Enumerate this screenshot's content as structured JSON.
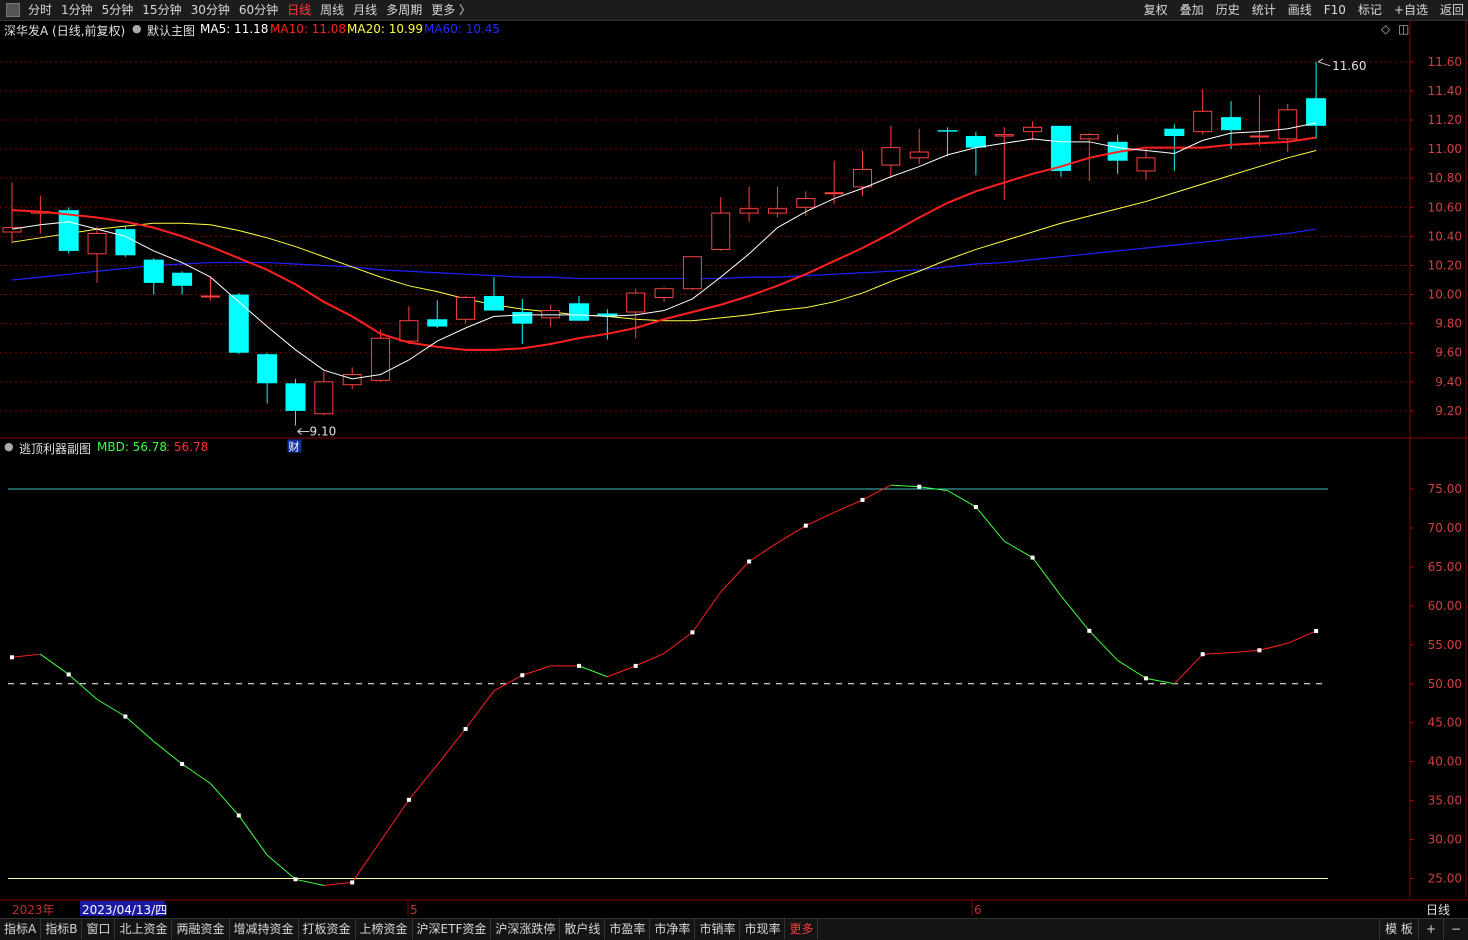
{
  "toolbar": {
    "periods": [
      {
        "label": "分时",
        "active": false
      },
      {
        "label": "1分钟",
        "active": false
      },
      {
        "label": "5分钟",
        "active": false
      },
      {
        "label": "15分钟",
        "active": false
      },
      {
        "label": "30分钟",
        "active": false
      },
      {
        "label": "60分钟",
        "active": false
      },
      {
        "label": "日线",
        "active": true
      },
      {
        "label": "周线",
        "active": false
      },
      {
        "label": "月线",
        "active": false
      },
      {
        "label": "多周期",
        "active": false
      },
      {
        "label": "更多 〉",
        "active": false
      }
    ],
    "right_items": [
      "复权",
      "叠加",
      "历史",
      "统计",
      "画线",
      "F10",
      "标记",
      "+自选",
      "返回"
    ]
  },
  "main_chart": {
    "title": "深华发A (日线,前复权)",
    "template": "默认主图",
    "ma5": {
      "label": "MA5: 11.18",
      "color": "#ffffff"
    },
    "ma10": {
      "label": "MA10: 11.08",
      "color": "#ff2020"
    },
    "ma20": {
      "label": "MA20: 10.99",
      "color": "#ffff40"
    },
    "ma60": {
      "label": "MA60: 10.45",
      "color": "#2020ff"
    },
    "high_label": "11.60",
    "low_label": "9.10",
    "finance_marker": "财",
    "price_ticks": [
      "11.60",
      "11.40",
      "11.20",
      "11.00",
      "10.80",
      "10.60",
      "10.40",
      "10.20",
      "10.00",
      "9.80",
      "9.60",
      "9.40",
      "9.20"
    ]
  },
  "sub_chart": {
    "title": "逃顶利器副图",
    "mbd_label": "MBD: 56.78",
    "mbd_value": ": 56.78",
    "ticks": [
      "75.00",
      "70.00",
      "65.00",
      "60.00",
      "55.00",
      "50.00",
      "45.00",
      "40.00",
      "35.00",
      "30.00",
      "25.00"
    ]
  },
  "time_axis": {
    "year_label": "2023年",
    "cursor_date": "2023/04/13/四",
    "month_5": "5",
    "month_6": "6",
    "period_label": "日线"
  },
  "bottom_tabs": [
    {
      "label": "指标A",
      "active": false
    },
    {
      "label": "指标B",
      "active": false
    },
    {
      "label": "窗口",
      "active": false
    },
    {
      "label": "北上资金",
      "active": false
    },
    {
      "label": "两融资金",
      "active": false
    },
    {
      "label": "增减持资金",
      "active": false
    },
    {
      "label": "打板资金",
      "active": false
    },
    {
      "label": "上榜资金",
      "active": false
    },
    {
      "label": "沪深ETF资金",
      "active": false
    },
    {
      "label": "沪深涨跌停",
      "active": false
    },
    {
      "label": "散户线",
      "active": false
    },
    {
      "label": "市盈率",
      "active": false
    },
    {
      "label": "市净率",
      "active": false
    },
    {
      "label": "市销率",
      "active": false
    },
    {
      "label": "市现率",
      "active": false
    },
    {
      "label": "更多",
      "active": true
    }
  ],
  "bottom_right": {
    "template_label": "模 板",
    "plus": "+",
    "minus": "−"
  },
  "colors": {
    "up": "#ff4040",
    "down": "#00ffff",
    "ma5": "#ffffff",
    "ma10": "#ff2020",
    "ma20": "#ffff40",
    "ma60": "#2020ff",
    "mbd_up": "#ff2020",
    "mbd_down": "#40ff40",
    "grid": "#7a0000"
  },
  "chart_data": [
    {
      "type": "candlestick",
      "title": "深华发A (日线,前复权)",
      "candles": [
        {
          "o": 10.43,
          "h": 10.77,
          "l": 10.35,
          "c": 10.46
        },
        {
          "o": 10.56,
          "h": 10.68,
          "l": 10.42,
          "c": 10.57
        },
        {
          "o": 10.58,
          "h": 10.6,
          "l": 10.28,
          "c": 10.3
        },
        {
          "o": 10.28,
          "h": 10.47,
          "l": 10.08,
          "c": 10.42
        },
        {
          "o": 10.45,
          "h": 10.47,
          "l": 10.26,
          "c": 10.27
        },
        {
          "o": 10.24,
          "h": 10.25,
          "l": 10.0,
          "c": 10.08
        },
        {
          "o": 10.15,
          "h": 10.16,
          "l": 10.0,
          "c": 10.06
        },
        {
          "o": 9.99,
          "h": 10.12,
          "l": 9.96,
          "c": 9.99
        },
        {
          "o": 10.0,
          "h": 10.01,
          "l": 9.59,
          "c": 9.6
        },
        {
          "o": 9.59,
          "h": 9.6,
          "l": 9.25,
          "c": 9.39
        },
        {
          "o": 9.39,
          "h": 9.42,
          "l": 9.1,
          "c": 9.2
        },
        {
          "o": 9.18,
          "h": 9.47,
          "l": 9.17,
          "c": 9.4
        },
        {
          "o": 9.38,
          "h": 9.5,
          "l": 9.35,
          "c": 9.45
        },
        {
          "o": 9.41,
          "h": 9.76,
          "l": 9.4,
          "c": 9.7
        },
        {
          "o": 9.68,
          "h": 9.92,
          "l": 9.66,
          "c": 9.82
        },
        {
          "o": 9.83,
          "h": 9.96,
          "l": 9.77,
          "c": 9.78
        },
        {
          "o": 9.83,
          "h": 9.99,
          "l": 9.8,
          "c": 9.98
        },
        {
          "o": 9.99,
          "h": 10.12,
          "l": 9.89,
          "c": 9.89
        },
        {
          "o": 9.88,
          "h": 9.97,
          "l": 9.66,
          "c": 9.8
        },
        {
          "o": 9.84,
          "h": 9.93,
          "l": 9.78,
          "c": 9.89
        },
        {
          "o": 9.94,
          "h": 9.99,
          "l": 9.83,
          "c": 9.82
        },
        {
          "o": 9.87,
          "h": 9.9,
          "l": 9.69,
          "c": 9.85
        },
        {
          "o": 9.88,
          "h": 10.04,
          "l": 9.7,
          "c": 10.01
        },
        {
          "o": 9.98,
          "h": 10.05,
          "l": 9.95,
          "c": 10.04
        },
        {
          "o": 10.04,
          "h": 10.26,
          "l": 10.03,
          "c": 10.26
        },
        {
          "o": 10.31,
          "h": 10.67,
          "l": 10.3,
          "c": 10.56
        },
        {
          "o": 10.56,
          "h": 10.74,
          "l": 10.5,
          "c": 10.59
        },
        {
          "o": 10.56,
          "h": 10.74,
          "l": 10.53,
          "c": 10.59
        },
        {
          "o": 10.6,
          "h": 10.71,
          "l": 10.54,
          "c": 10.66
        },
        {
          "o": 10.7,
          "h": 10.92,
          "l": 10.62,
          "c": 10.7
        },
        {
          "o": 10.74,
          "h": 10.99,
          "l": 10.68,
          "c": 10.86
        },
        {
          "o": 10.89,
          "h": 11.16,
          "l": 10.8,
          "c": 11.01
        },
        {
          "o": 10.94,
          "h": 11.14,
          "l": 10.9,
          "c": 10.98
        },
        {
          "o": 11.13,
          "h": 11.15,
          "l": 10.95,
          "c": 11.12
        },
        {
          "o": 11.09,
          "h": 11.12,
          "l": 10.82,
          "c": 11.01
        },
        {
          "o": 11.09,
          "h": 11.15,
          "l": 10.65,
          "c": 11.1
        },
        {
          "o": 11.12,
          "h": 11.19,
          "l": 11.06,
          "c": 11.15
        },
        {
          "o": 11.16,
          "h": 11.16,
          "l": 10.81,
          "c": 10.85
        },
        {
          "o": 11.07,
          "h": 11.11,
          "l": 10.78,
          "c": 11.1
        },
        {
          "o": 11.05,
          "h": 11.1,
          "l": 10.83,
          "c": 10.92
        },
        {
          "o": 10.85,
          "h": 11.0,
          "l": 10.79,
          "c": 10.94
        },
        {
          "o": 11.14,
          "h": 11.17,
          "l": 10.85,
          "c": 11.09
        },
        {
          "o": 11.12,
          "h": 11.41,
          "l": 11.1,
          "c": 11.26
        },
        {
          "o": 11.22,
          "h": 11.33,
          "l": 11.0,
          "c": 11.13
        },
        {
          "o": 11.09,
          "h": 11.37,
          "l": 11.02,
          "c": 11.09
        },
        {
          "o": 11.07,
          "h": 11.31,
          "l": 10.98,
          "c": 11.27
        },
        {
          "o": 11.35,
          "h": 11.6,
          "l": 11.07,
          "c": 11.16
        }
      ],
      "ma5": [
        10.45,
        10.48,
        10.5,
        10.45,
        10.4,
        10.3,
        10.22,
        10.12,
        9.95,
        9.78,
        9.62,
        9.48,
        9.42,
        9.45,
        9.55,
        9.68,
        9.77,
        9.85,
        9.86,
        9.86,
        9.86,
        9.85,
        9.86,
        9.89,
        9.97,
        10.12,
        10.28,
        10.46,
        10.57,
        10.66,
        10.73,
        10.81,
        10.88,
        10.96,
        11.01,
        11.04,
        11.07,
        11.05,
        11.05,
        11.01,
        10.99,
        10.97,
        11.06,
        11.11,
        11.12,
        11.14,
        11.18
      ],
      "ma10": [
        10.58,
        10.57,
        10.55,
        10.53,
        10.5,
        10.46,
        10.4,
        10.33,
        10.25,
        10.17,
        10.07,
        9.95,
        9.85,
        9.73,
        9.67,
        9.64,
        9.62,
        9.62,
        9.63,
        9.66,
        9.7,
        9.73,
        9.77,
        9.83,
        9.88,
        9.93,
        9.99,
        10.06,
        10.14,
        10.23,
        10.32,
        10.42,
        10.53,
        10.63,
        10.71,
        10.77,
        10.83,
        10.88,
        10.94,
        10.98,
        11.01,
        11.01,
        11.01,
        11.03,
        11.04,
        11.05,
        11.08
      ],
      "ma20": [
        10.36,
        10.39,
        10.42,
        10.45,
        10.47,
        10.49,
        10.49,
        10.48,
        10.44,
        10.39,
        10.33,
        10.26,
        10.19,
        10.12,
        10.06,
        10.02,
        9.97,
        9.93,
        9.9,
        9.88,
        9.86,
        9.85,
        9.83,
        9.82,
        9.82,
        9.84,
        9.86,
        9.89,
        9.91,
        9.95,
        10.01,
        10.09,
        10.16,
        10.24,
        10.31,
        10.37,
        10.43,
        10.49,
        10.54,
        10.59,
        10.64,
        10.7,
        10.76,
        10.82,
        10.88,
        10.94,
        10.99
      ],
      "ma60": [
        10.1,
        10.12,
        10.14,
        10.16,
        10.18,
        10.2,
        10.21,
        10.22,
        10.22,
        10.22,
        10.21,
        10.2,
        10.19,
        10.17,
        10.16,
        10.15,
        10.14,
        10.13,
        10.12,
        10.12,
        10.11,
        10.11,
        10.11,
        10.11,
        10.11,
        10.11,
        10.12,
        10.12,
        10.13,
        10.14,
        10.15,
        10.16,
        10.17,
        10.19,
        10.21,
        10.22,
        10.24,
        10.26,
        10.28,
        10.3,
        10.32,
        10.34,
        10.36,
        10.38,
        10.4,
        10.42,
        10.45
      ],
      "ylim": [
        9.0,
        11.75
      ]
    },
    {
      "type": "line",
      "title": "逃顶利器副图",
      "series": [
        {
          "name": "MBD",
          "values": [
            53.4,
            53.8,
            51.2,
            48.0,
            45.8,
            42.6,
            39.7,
            37.2,
            33.1,
            28.0,
            24.9,
            24.1,
            24.5,
            29.8,
            35.1,
            39.6,
            44.2,
            49.1,
            51.1,
            52.3,
            52.3,
            50.9,
            52.3,
            53.9,
            56.6,
            61.8,
            65.7,
            68.1,
            70.3,
            72.0,
            73.6,
            75.5,
            75.3,
            74.8,
            72.7,
            68.3,
            66.2,
            61.3,
            56.8,
            53.0,
            50.7,
            50.0,
            53.8,
            54.0,
            54.3,
            55.2,
            56.78
          ]
        }
      ],
      "reference_lines": [
        75,
        50,
        25
      ],
      "ylim": [
        22.5,
        79.5
      ]
    }
  ]
}
